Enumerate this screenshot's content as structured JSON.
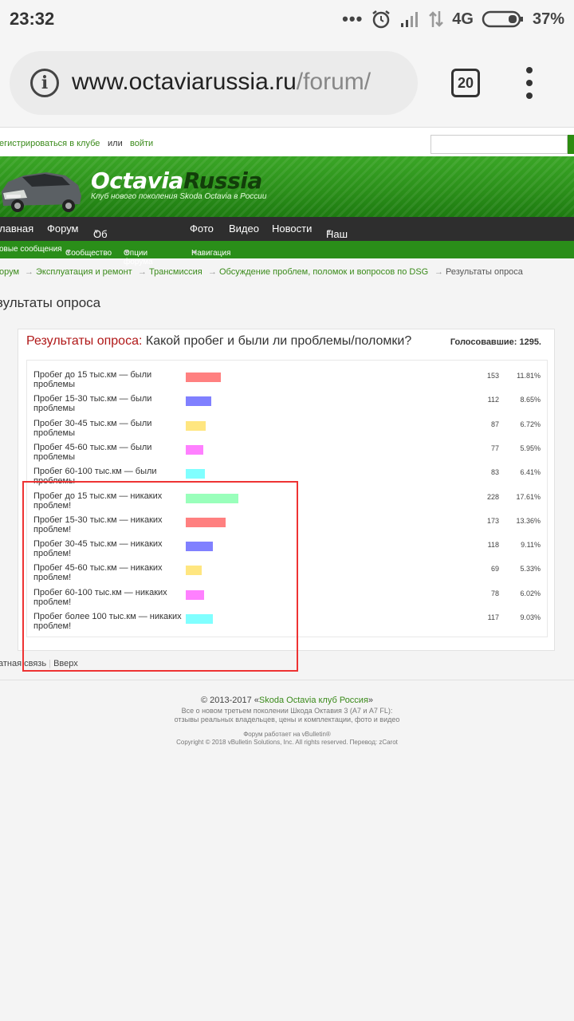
{
  "status": {
    "time": "23:32",
    "network": "4G",
    "battery": "37%"
  },
  "browser": {
    "url_host": "www.octaviarussia.ru",
    "url_path": "/forum/",
    "tab_count": "20"
  },
  "toplinks": {
    "register": "егистрироваться в клубе",
    "or": "или",
    "login": "войти"
  },
  "banner": {
    "logo_part1": "Octavia",
    "logo_part2": "Russia",
    "slogan": "Клуб нового поколения Skoda Octavia в России"
  },
  "nav_main": [
    "лавная",
    "Форум",
    "Об автомобиле",
    "Фото",
    "Видео",
    "Новости",
    "Наш клуб"
  ],
  "nav_sub": [
    "овые сообщения",
    "Сообщество",
    "Опции форума",
    "Навигация"
  ],
  "breadcrumb": [
    "орум",
    "Эксплуатация и ремонт",
    "Трансмиссия",
    "Обсуждение проблем, поломок и вопросов по DSG",
    "Результаты опроса"
  ],
  "page_title": "зультаты опроса",
  "poll": {
    "title_prefix": "Результаты опроса:",
    "question": "Какой пробег и были ли проблемы/поломки?",
    "voters": "Голосовавшие: 1295.",
    "options": [
      {
        "label": "Пробег до 15 тыс.км — были проблемы",
        "count": "153",
        "percent": "11.81%",
        "value": 11.81,
        "color": "#ff8080"
      },
      {
        "label": "Пробег 15-30 тыс.км — были проблемы",
        "count": "112",
        "percent": "8.65%",
        "value": 8.65,
        "color": "#8080ff"
      },
      {
        "label": "Пробег 30-45 тыс.км — были проблемы",
        "count": "87",
        "percent": "6.72%",
        "value": 6.72,
        "color": "#ffe680"
      },
      {
        "label": "Пробег 45-60 тыс.км — были проблемы",
        "count": "77",
        "percent": "5.95%",
        "value": 5.95,
        "color": "#ff80ff"
      },
      {
        "label": "Пробег 60-100 тыс.км — были проблемы",
        "count": "83",
        "percent": "6.41%",
        "value": 6.41,
        "color": "#80ffff"
      },
      {
        "label": "Пробег до 15 тыс.км — никаких проблем!",
        "count": "228",
        "percent": "17.61%",
        "value": 17.61,
        "color": "#99ffbb"
      },
      {
        "label": "Пробег 15-30 тыс.км — никаких проблем!",
        "count": "173",
        "percent": "13.36%",
        "value": 13.36,
        "color": "#ff8080"
      },
      {
        "label": "Пробег 30-45 тыс.км — никаких проблем!",
        "count": "118",
        "percent": "9.11%",
        "value": 9.11,
        "color": "#8080ff"
      },
      {
        "label": "Пробег 45-60 тыс.км — никаких проблем!",
        "count": "69",
        "percent": "5.33%",
        "value": 5.33,
        "color": "#ffe680"
      },
      {
        "label": "Пробег 60-100 тыс.км — никаких проблем!",
        "count": "78",
        "percent": "6.02%",
        "value": 6.02,
        "color": "#ff80ff"
      },
      {
        "label": "Пробег более 100 тыс.км — никаких проблем!",
        "count": "117",
        "percent": "9.03%",
        "value": 9.03,
        "color": "#80ffff"
      }
    ]
  },
  "bottom": {
    "feedback": "атная связь",
    "top": "Вверх"
  },
  "footer": {
    "copyright_prefix": "© 2013-2017 «",
    "club_link": "Skoda Octavia клуб Россия",
    "copyright_suffix": "»",
    "line2": "Все о новом третьем поколении Шкода Октавия 3 (А7 и А7 FL):",
    "line3": "отзывы реальных владельцев, цены и комплектации, фото и видео",
    "line4": "Форум работает на vBulletin®",
    "line5": "Copyright © 2018 vBulletin Solutions, Inc. All rights reserved. Перевод: zCarot"
  }
}
